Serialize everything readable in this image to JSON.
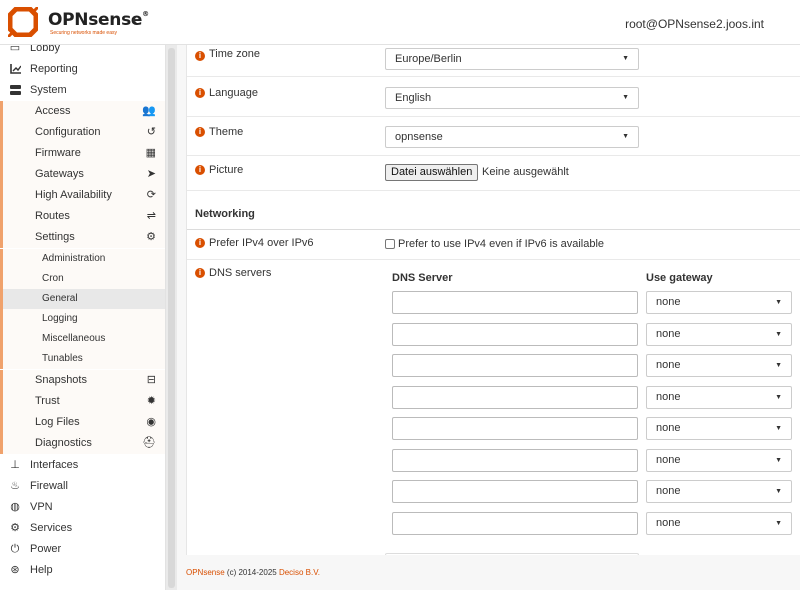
{
  "header": {
    "brand": "OPNsense",
    "reg": "®",
    "tagline": "Securing networks made easy",
    "collapse_icon": "chevron-left-icon",
    "user": "root@OPNsense2.joos.int"
  },
  "sidebar": {
    "top": [
      {
        "label": "Lobby",
        "icon": "laptop-icon"
      },
      {
        "label": "Reporting",
        "icon": "chart-icon"
      },
      {
        "label": "System",
        "icon": "server-icon"
      }
    ],
    "system_items": [
      {
        "label": "Access",
        "icon": "users-icon"
      },
      {
        "label": "Configuration",
        "icon": "history-icon"
      },
      {
        "label": "Firmware",
        "icon": "calculator-icon"
      },
      {
        "label": "Gateways",
        "icon": "location-arrow-icon"
      },
      {
        "label": "High Availability",
        "icon": "refresh-icon"
      },
      {
        "label": "Routes",
        "icon": "signs-icon"
      },
      {
        "label": "Settings",
        "icon": "cogs-icon"
      }
    ],
    "settings_items": [
      {
        "label": "Administration"
      },
      {
        "label": "Cron"
      },
      {
        "label": "General"
      },
      {
        "label": "Logging"
      },
      {
        "label": "Miscellaneous"
      },
      {
        "label": "Tunables"
      }
    ],
    "system_items2": [
      {
        "label": "Snapshots",
        "icon": "hdd-icon"
      },
      {
        "label": "Trust",
        "icon": "certificate-icon"
      },
      {
        "label": "Log Files",
        "icon": "eye-icon"
      },
      {
        "label": "Diagnostics",
        "icon": "medkit-icon"
      }
    ],
    "bottom": [
      {
        "label": "Interfaces",
        "icon": "sitemap-icon"
      },
      {
        "label": "Firewall",
        "icon": "fire-icon"
      },
      {
        "label": "VPN",
        "icon": "globe-icon"
      },
      {
        "label": "Services",
        "icon": "cog-icon"
      },
      {
        "label": "Power",
        "icon": "plug-icon"
      },
      {
        "label": "Help",
        "icon": "life-ring-icon"
      }
    ]
  },
  "form": {
    "timezone": {
      "label": "Time zone",
      "value": "Europe/Berlin"
    },
    "language": {
      "label": "Language",
      "value": "English"
    },
    "theme": {
      "label": "Theme",
      "value": "opnsense"
    },
    "picture": {
      "label": "Picture",
      "button": "Datei auswählen",
      "status": "Keine ausgewählt"
    },
    "networking": {
      "heading": "Networking"
    },
    "prefer_ipv4": {
      "label": "Prefer IPv4 over IPv6",
      "checkbox_label": "Prefer to use IPv4 even if IPv6 is available",
      "checked": false
    },
    "dns": {
      "label": "DNS servers",
      "col_server": "DNS Server",
      "col_gateway": "Use gateway",
      "rows": [
        {
          "server": "",
          "gateway": "none"
        },
        {
          "server": "",
          "gateway": "none"
        },
        {
          "server": "",
          "gateway": "none"
        },
        {
          "server": "",
          "gateway": "none"
        },
        {
          "server": "",
          "gateway": "none"
        },
        {
          "server": "",
          "gateway": "none"
        },
        {
          "server": "",
          "gateway": "none"
        },
        {
          "server": "",
          "gateway": "none"
        }
      ]
    }
  },
  "footer": {
    "brand": "OPNsense",
    "copy": " (c) 2014-2025 ",
    "company": "Deciso B.V."
  }
}
